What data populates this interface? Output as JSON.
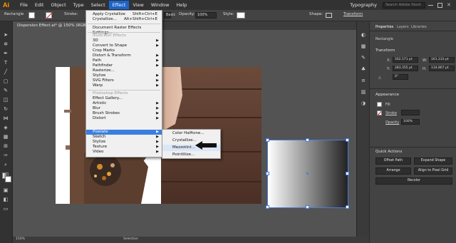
{
  "app": {
    "logo": "Ai"
  },
  "menubar": {
    "items": [
      "File",
      "Edit",
      "Object",
      "Type",
      "Select",
      "Effect",
      "View",
      "Window",
      "Help"
    ],
    "active": "Effect",
    "workspace": "Typography",
    "search_placeholder": "Search Adobe Stock"
  },
  "controlbar": {
    "selection_label": "Rectangle",
    "stroke_label": "Stroke:",
    "style_basic": "Basic",
    "opacity_label": "Opacity:",
    "opacity_value": "100%",
    "style_label": "Style:",
    "shape_label": "Shape:",
    "transform_label": "Transform"
  },
  "document": {
    "tab_title": "Dispersion Effect.ai* @ 150% (RGB/GPU Preview)"
  },
  "effect_menu": {
    "items": [
      {
        "label": "Apply Crystallize",
        "shortcut": "Shift+Ctrl+E"
      },
      {
        "label": "Crystallize...",
        "shortcut": "Alt+Shift+Ctrl+E"
      },
      {
        "label": "Document Raster Effects Settings..."
      },
      {
        "label": "Illustrator Effects",
        "header": true
      },
      {
        "label": "3D",
        "submenu": true
      },
      {
        "label": "Convert to Shape",
        "submenu": true
      },
      {
        "label": "Crop Marks"
      },
      {
        "label": "Distort & Transform",
        "submenu": true
      },
      {
        "label": "Path",
        "submenu": true
      },
      {
        "label": "Pathfinder",
        "submenu": true
      },
      {
        "label": "Rasterize..."
      },
      {
        "label": "Stylize",
        "submenu": true
      },
      {
        "label": "SVG Filters",
        "submenu": true
      },
      {
        "label": "Warp",
        "submenu": true
      },
      {
        "label": "Photoshop Effects",
        "header": true
      },
      {
        "label": "Effect Gallery..."
      },
      {
        "label": "Artistic",
        "submenu": true
      },
      {
        "label": "Blur",
        "submenu": true
      },
      {
        "label": "Brush Strokes",
        "submenu": true
      },
      {
        "label": "Distort",
        "submenu": true
      },
      {
        "label": "Pixelate",
        "submenu": true,
        "highlight": true
      },
      {
        "label": "Sketch",
        "submenu": true
      },
      {
        "label": "Stylize",
        "submenu": true
      },
      {
        "label": "Texture",
        "submenu": true
      },
      {
        "label": "Video",
        "submenu": true
      }
    ]
  },
  "pixelate_submenu": {
    "items": [
      "Color Halftone...",
      "Crystallize...",
      "Mezzotint...",
      "Pointillize..."
    ],
    "highlight": "Mezzotint..."
  },
  "properties_panel": {
    "tabs": [
      "Properties",
      "Layers",
      "Libraries"
    ],
    "active_tab": "Properties",
    "selection_type": "Rectangle",
    "transform": {
      "title": "Transform",
      "x": "562.571 pt",
      "y": "283.355 pt",
      "w": "161.233 pt",
      "h": "134.867 pt",
      "angle": "0°"
    },
    "appearance": {
      "title": "Appearance",
      "fill_label": "Fill",
      "stroke_label": "Stroke",
      "opacity_label": "Opacity",
      "opacity_value": "100%"
    },
    "quick_actions": {
      "title": "Quick Actions",
      "buttons": [
        "Offset Path",
        "Expand Shape",
        "Arrange",
        "Align to Pixel Grid",
        "Recolor"
      ]
    }
  },
  "statusbar": {
    "zoom": "150%",
    "mode": "Selection"
  }
}
